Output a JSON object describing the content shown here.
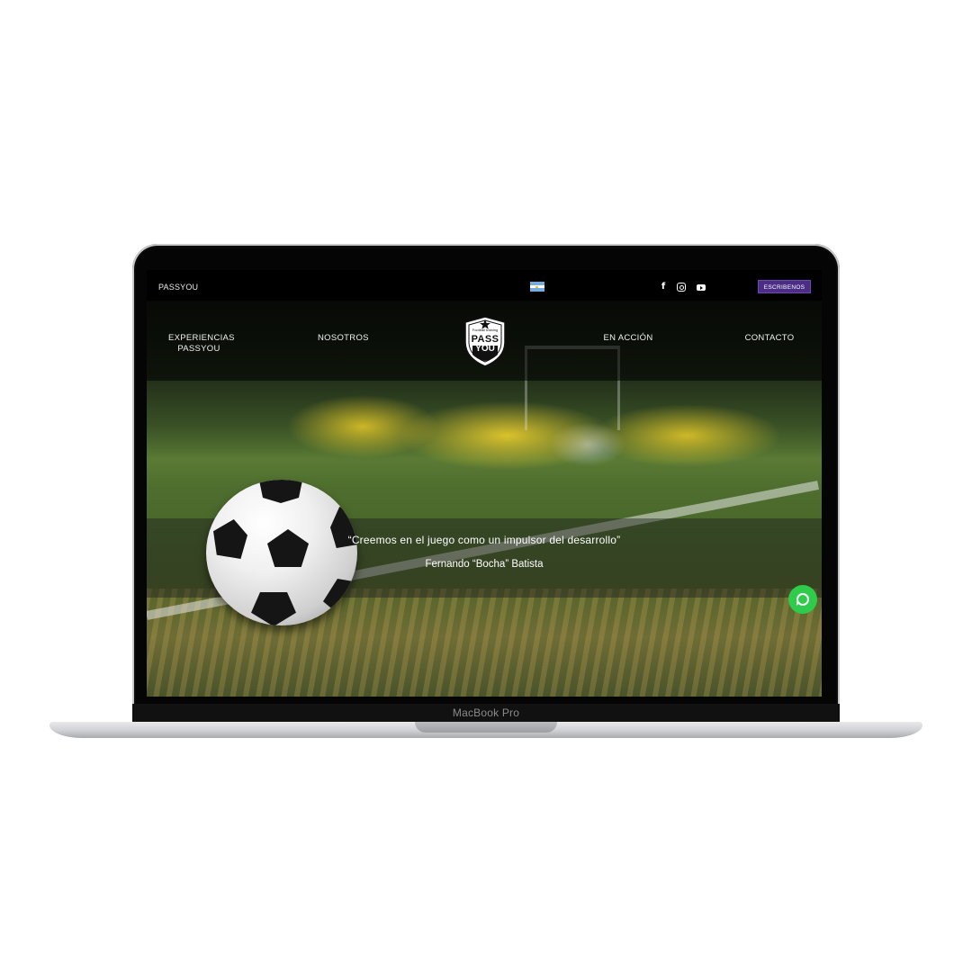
{
  "device": {
    "label": "MacBook Pro"
  },
  "topbar": {
    "brand": "PASSYOU",
    "language_flag": "argentina-flag-icon",
    "social": [
      "facebook-icon",
      "instagram-icon",
      "youtube-icon"
    ],
    "cta_label": "ESCRIBENOS",
    "cta_color": "#4b2d86"
  },
  "nav": {
    "items": [
      {
        "label": "EXPERIENCIAS\nPASSYOU"
      },
      {
        "label": "NOSOTROS"
      },
      {
        "label": "EN ACCIÓN"
      },
      {
        "label": "CONTACTO"
      }
    ],
    "logo": {
      "top": "Football training",
      "line1": "PASS",
      "line2": "YOU"
    }
  },
  "hero": {
    "quote": "“Creemos en el juego como un impulsor del desarrollo”",
    "author": "Fernando “Bocha” Batista"
  },
  "whatsapp": {
    "icon": "whatsapp-icon",
    "color": "#2ecc4a"
  }
}
